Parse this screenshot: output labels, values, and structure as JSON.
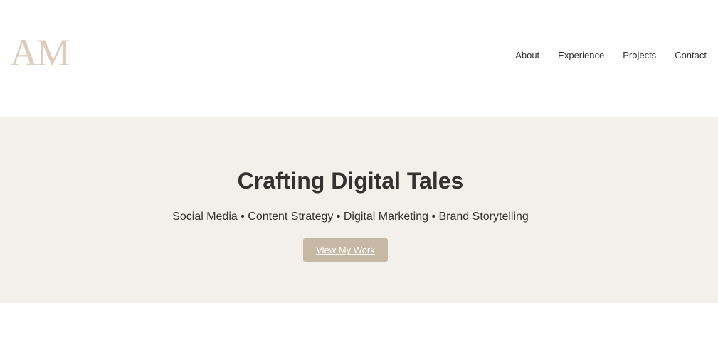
{
  "header": {
    "logo_text": "AM",
    "nav": {
      "about": "About",
      "experience": "Experience",
      "projects": "Projects",
      "contact": "Contact"
    }
  },
  "hero": {
    "title": "Crafting Digital Tales",
    "subtitle": "Social Media • Content Strategy • Digital Marketing • Brand Storytelling",
    "cta_label": "View My Work"
  },
  "colors": {
    "logo": "#dccdbe",
    "hero_background": "#f3f0eb",
    "button": "#c7b8a5",
    "text": "#333230"
  }
}
